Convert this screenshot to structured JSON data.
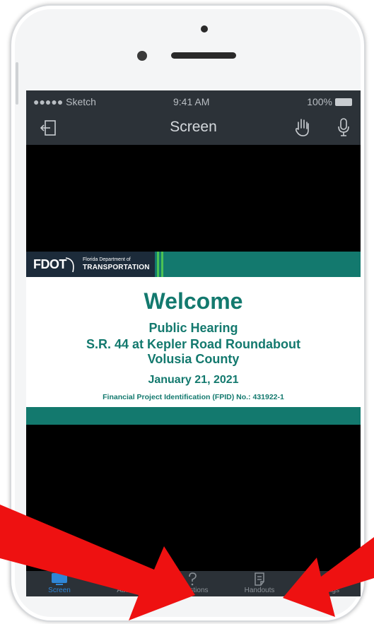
{
  "status_bar": {
    "carrier": "●●●●● Sketch",
    "time": "9:41 AM",
    "battery": "100%"
  },
  "nav": {
    "title": "Screen"
  },
  "slide": {
    "logo_text": "FDOT",
    "logo_line1": "Florida Department of",
    "logo_line2": "TRANSPORTATION",
    "welcome": "Welcome",
    "subtitle": "Public Hearing",
    "project": "S.R. 44 at Kepler Road Roundabout",
    "county": "Volusia County",
    "date": "January 21, 2021",
    "fpid": "Financial Project Identification (FPID) No.: 431922-1"
  },
  "tabs": [
    {
      "label": "Screen",
      "icon": "monitor-icon",
      "active": true
    },
    {
      "label": "Audio",
      "icon": "speaker-icon",
      "active": false
    },
    {
      "label": "Questions",
      "icon": "question-icon",
      "active": false
    },
    {
      "label": "Handouts",
      "icon": "handout-icon",
      "active": false
    },
    {
      "label": "Settings",
      "icon": "gear-icon",
      "active": false
    }
  ],
  "colors": {
    "accent": "#2f86d6",
    "fdot_green": "#13796e",
    "arrow_red": "#ee1111",
    "bar": "#2c3238"
  }
}
